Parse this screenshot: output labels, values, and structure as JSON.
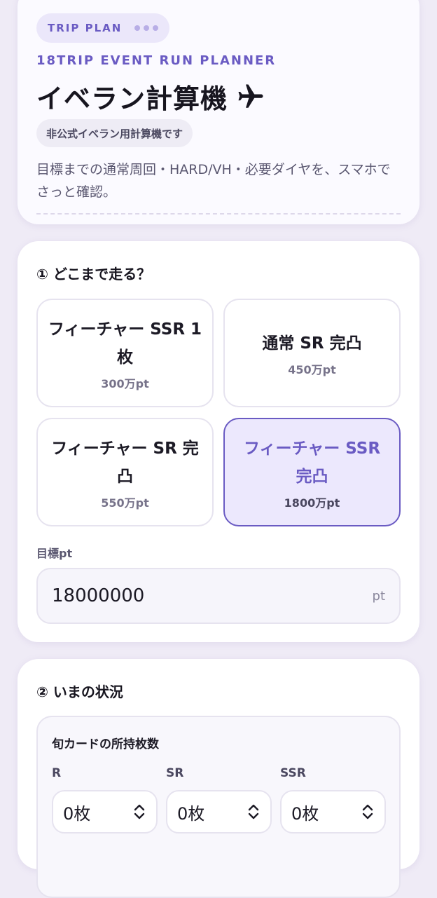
{
  "header": {
    "tag": "TRIP PLAN",
    "subtitle": "18TRIP EVENT RUN PLANNER",
    "title": "イベラン計算機",
    "note": "非公式イベラン用計算機です",
    "description": "目標までの通常周回・HARD/VH・必要ダイヤを、スマホでさっと確認。"
  },
  "goal_section": {
    "title": "① どこまで走る？",
    "options": [
      {
        "name": "フィーチャー SSR 1枚",
        "points": "300万pt",
        "selected": false
      },
      {
        "name": "通常 SR 完凸",
        "points": "450万pt",
        "selected": false
      },
      {
        "name": "フィーチャー SR 完凸",
        "points": "550万pt",
        "selected": false
      },
      {
        "name": "フィーチャー SSR 完凸",
        "points": "1800万pt",
        "selected": true
      }
    ],
    "target_label": "目標pt",
    "target_value": "18000000",
    "target_unit": "pt"
  },
  "status_section": {
    "title": "② いまの状況",
    "card_title": "旬カードの所持枚数",
    "selects": [
      {
        "label": "R",
        "value": "0枚"
      },
      {
        "label": "SR",
        "value": "0枚"
      },
      {
        "label": "SSR",
        "value": "0枚"
      }
    ]
  },
  "colors": {
    "accent": "#6a5bc3",
    "selected_bg": "#ece8fd",
    "page_bg": "#efebf6"
  }
}
